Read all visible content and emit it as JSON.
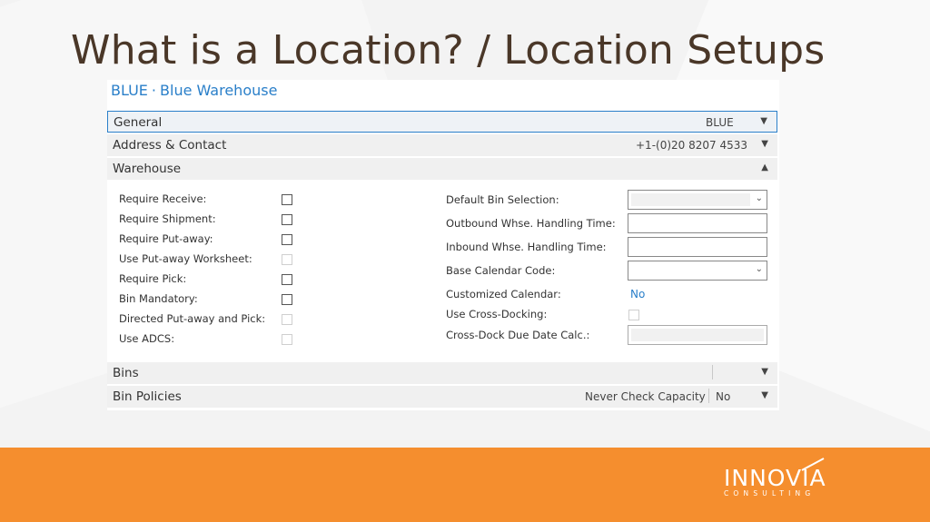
{
  "slide": {
    "title": "What is a Location? / Location Setups"
  },
  "card": {
    "code": "BLUE",
    "separator": "·",
    "name": "Blue Warehouse"
  },
  "sections": {
    "general": {
      "label": "General",
      "value": "BLUE"
    },
    "address": {
      "label": "Address & Contact",
      "value": "+1-(0)20 8207 4533"
    },
    "warehouse": {
      "label": "Warehouse"
    },
    "bins": {
      "label": "Bins"
    },
    "bin_policies": {
      "label": "Bin Policies",
      "value_label": "Never Check Capacity",
      "value": "No"
    }
  },
  "warehouse_left": [
    {
      "label": "Require Receive:",
      "checked": false,
      "enabled": true
    },
    {
      "label": "Require Shipment:",
      "checked": false,
      "enabled": true
    },
    {
      "label": "Require Put-away:",
      "checked": false,
      "enabled": true
    },
    {
      "label": "Use Put-away Worksheet:",
      "checked": false,
      "enabled": false
    },
    {
      "label": "Require Pick:",
      "checked": false,
      "enabled": true
    },
    {
      "label": "Bin Mandatory:",
      "checked": false,
      "enabled": true
    },
    {
      "label": "Directed Put-away and Pick:",
      "checked": false,
      "enabled": false
    },
    {
      "label": "Use ADCS:",
      "checked": false,
      "enabled": false
    }
  ],
  "warehouse_right": {
    "default_bin_selection": {
      "label": "Default Bin Selection:",
      "value": ""
    },
    "outbound_handling": {
      "label": "Outbound Whse. Handling Time:",
      "value": ""
    },
    "inbound_handling": {
      "label": "Inbound Whse. Handling Time:",
      "value": ""
    },
    "base_calendar": {
      "label": "Base Calendar Code:",
      "value": ""
    },
    "customized_calendar": {
      "label": "Customized Calendar:",
      "value": "No"
    },
    "cross_docking": {
      "label": "Use Cross-Docking:"
    },
    "cross_dock_due": {
      "label": "Cross-Dock Due Date Calc.:",
      "value": ""
    }
  },
  "brand": {
    "name": "INNOVIA",
    "tagline": "CONSULTING"
  },
  "icons": {
    "chevron_down": "⌄",
    "chevron_up": "⌃"
  },
  "colors": {
    "accent": "#2a7fc9",
    "footer": "#f58e2e",
    "title": "#4a3728"
  }
}
